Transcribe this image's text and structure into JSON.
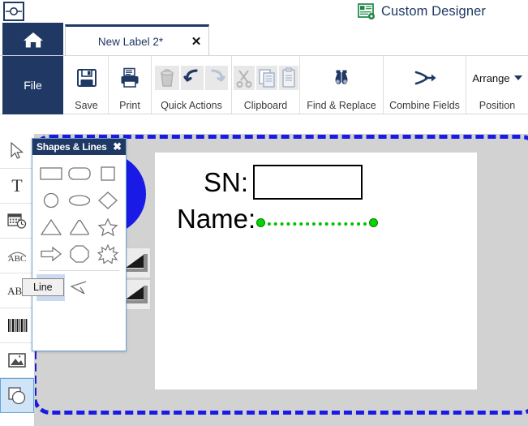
{
  "titlebar": {
    "app_icon_name": "app-logo-icon",
    "document_title": "Custom Designer",
    "document_icon_name": "custom-designer-icon"
  },
  "tabs": {
    "home_icon": "home-icon",
    "document_tab_label": "New Label 2*",
    "close_glyph": "✕"
  },
  "ribbon": {
    "file_label": "File",
    "groups": [
      {
        "label": "Save",
        "icons": [
          "save-icon"
        ]
      },
      {
        "label": "Print",
        "icons": [
          "print-icon"
        ]
      },
      {
        "label": "Quick Actions",
        "icons": [
          "delete-icon",
          "undo-icon",
          "redo-icon"
        ]
      },
      {
        "label": "Clipboard",
        "icons": [
          "cut-icon",
          "copy-icon",
          "paste-icon"
        ]
      },
      {
        "label": "Find & Replace",
        "icons": [
          "binoculars-icon"
        ]
      },
      {
        "label": "Combine Fields",
        "icons": [
          "combine-fields-icon"
        ]
      },
      {
        "label": "Position",
        "icons": [
          "arrange-dropdown"
        ],
        "dropdown_label": "Arrange"
      }
    ]
  },
  "left_tools": [
    {
      "name": "select-tool",
      "icon": "cursor-arrow-icon",
      "active": false
    },
    {
      "name": "text-tool",
      "icon": "text-t-icon",
      "active": false
    },
    {
      "name": "datetime-tool",
      "icon": "calendar-clock-icon",
      "active": false
    },
    {
      "name": "curved-text-tool",
      "icon": "curved-text-icon",
      "active": false
    },
    {
      "name": "text-effect-tool",
      "icon": "abc-effect-icon",
      "active": false
    },
    {
      "name": "barcode-tool",
      "icon": "barcode-icon",
      "active": false
    },
    {
      "name": "image-tool",
      "icon": "picture-icon",
      "active": false
    },
    {
      "name": "shapes-tool",
      "icon": "shapes-icon",
      "active": true
    }
  ],
  "shapes_panel": {
    "title": "Shapes & Lines",
    "close_glyph": "✖",
    "shapes": [
      {
        "name": "rectangle-shape",
        "selected": false
      },
      {
        "name": "rounded-rectangle-shape",
        "selected": false
      },
      {
        "name": "square-shape",
        "selected": false
      },
      {
        "name": "circle-shape",
        "selected": false
      },
      {
        "name": "ellipse-shape",
        "selected": false
      },
      {
        "name": "diamond-shape",
        "selected": false
      },
      {
        "name": "triangle-shape",
        "selected": false
      },
      {
        "name": "rounded-triangle-shape",
        "selected": false
      },
      {
        "name": "star-5-shape",
        "selected": false
      },
      {
        "name": "arrow-right-shape",
        "selected": false
      },
      {
        "name": "octagon-shape",
        "selected": false
      },
      {
        "name": "star-8-shape",
        "selected": false
      }
    ],
    "lines": [
      {
        "name": "line-shape",
        "selected": true
      },
      {
        "name": "polyline-shape",
        "selected": false
      }
    ],
    "tooltip": "Line"
  },
  "canvas": {
    "sn_label": "SN:",
    "sn_field_value": "",
    "name_label": "Name:",
    "selected_object": "name-underline-line",
    "selection_color": "#00d800",
    "blue_circle_color": "#1a1ae6",
    "frame_color": "#1a1ae6"
  }
}
